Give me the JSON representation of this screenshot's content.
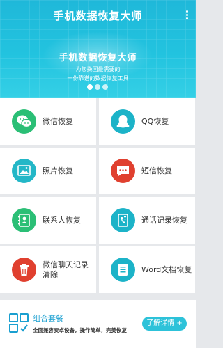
{
  "header": {
    "app_title": "手机数据恢复大师",
    "banner_title": "手机数据恢复大师",
    "banner_line1": "为您挽回最需要的",
    "banner_line2": "一份靠谱的数据恢复工具"
  },
  "tiles": [
    {
      "label": "微信恢复",
      "icon": "wechat-icon",
      "color": "#2bbf76"
    },
    {
      "label": "QQ恢复",
      "icon": "qq-penguin-icon",
      "color": "#1cb3c8"
    },
    {
      "label": "照片恢复",
      "icon": "photo-icon",
      "color": "#23b7c7"
    },
    {
      "label": "短信恢复",
      "icon": "message-icon",
      "color": "#e0402f"
    },
    {
      "label": "联系人恢复",
      "icon": "contacts-icon",
      "color": "#2bbf76"
    },
    {
      "label": "通话记录恢复",
      "icon": "call-log-icon",
      "color": "#1cb3c8"
    },
    {
      "label": "微信聊天记录清除",
      "icon": "trash-icon",
      "color": "#e0402f"
    },
    {
      "label": "Word文档恢复",
      "icon": "document-icon",
      "color": "#1cb3c8"
    }
  ],
  "combo": {
    "title": "组合套餐",
    "subtitle": "全面兼容安卓设备，操作简单，完美恢复",
    "button_label": "了解详情 +"
  },
  "colors": {
    "header": "#22c3df",
    "accent_blue": "#1a9fd0",
    "button": "#2dc2d9"
  }
}
